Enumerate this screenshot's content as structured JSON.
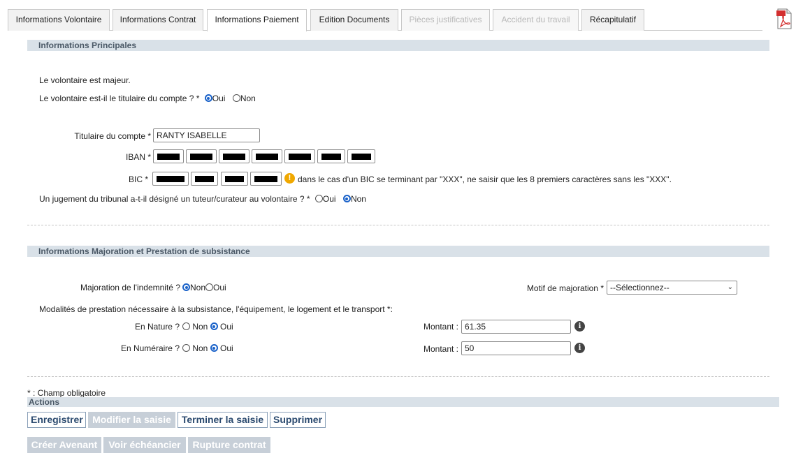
{
  "tabs": [
    {
      "label": "Informations Volontaire",
      "state": "normal"
    },
    {
      "label": "Informations Contrat",
      "state": "normal"
    },
    {
      "label": "Informations Paiement",
      "state": "active"
    },
    {
      "label": "Edition Documents",
      "state": "normal"
    },
    {
      "label": "Pièces justificatives",
      "state": "disabled"
    },
    {
      "label": "Accident du travail",
      "state": "disabled"
    },
    {
      "label": "Récapitulatif",
      "state": "normal"
    }
  ],
  "principal": {
    "header": "Informations Principales",
    "majeur_text": "Le volontaire est majeur.",
    "titulaire_question": "Le volontaire est-il le titulaire du compte ? *",
    "titulaire_yes": "Oui",
    "titulaire_no": "Non",
    "titulaire_selected": "Oui",
    "account_holder_label": "Titulaire du compte *",
    "account_holder_value": "RANTY ISABELLE",
    "iban_label": "IBAN *",
    "bic_label": "BIC *",
    "bic_note": "dans le cas d'un BIC se terminant par \"XXX\", ne saisir que les 8 premiers caractères sans les \"XXX\".",
    "tuteur_question": "Un jugement du tribunal a-t-il désigné un tuteur/curateur au volontaire ? *",
    "tuteur_yes": "Oui",
    "tuteur_no": "Non",
    "tuteur_selected": "Non"
  },
  "majoration": {
    "header": "Informations Majoration et Prestation de subsistance",
    "question": "Majoration de l'indemnité ?",
    "no": "Non",
    "yes": "Oui",
    "selected": "Non",
    "motif_label": "Motif de majoration *",
    "motif_value": "--Sélectionnez--",
    "modalites_text": "Modalités de prestation nécessaire à la subsistance, l'équipement, le logement et le transport *:",
    "nature_label": "En Nature ?",
    "nature_selected": "Oui",
    "numeraire_label": "En Numéraire ?",
    "numeraire_selected": "Oui",
    "montant_label": "Montant :",
    "nature_amount": "61.35",
    "numeraire_amount": "50"
  },
  "footnote": "* : Champ obligatoire",
  "actions": {
    "header": "Actions",
    "row1": [
      {
        "label": "Enregistrer",
        "enabled": true
      },
      {
        "label": "Modifier la saisie",
        "enabled": false
      },
      {
        "label": "Terminer la saisie",
        "enabled": true
      },
      {
        "label": "Supprimer",
        "enabled": true
      }
    ],
    "row2": [
      {
        "label": "Créer Avenant",
        "enabled": false
      },
      {
        "label": "Voir échéancier",
        "enabled": false
      },
      {
        "label": "Rupture contrat",
        "enabled": false
      }
    ]
  },
  "icons": {
    "pdf": "pdf-icon",
    "warning": "warning-icon",
    "info": "info-icon"
  },
  "colors": {
    "accent": "#1a62c9",
    "section_bg": "#d9e1e8",
    "button_text": "#2b4a6f"
  }
}
